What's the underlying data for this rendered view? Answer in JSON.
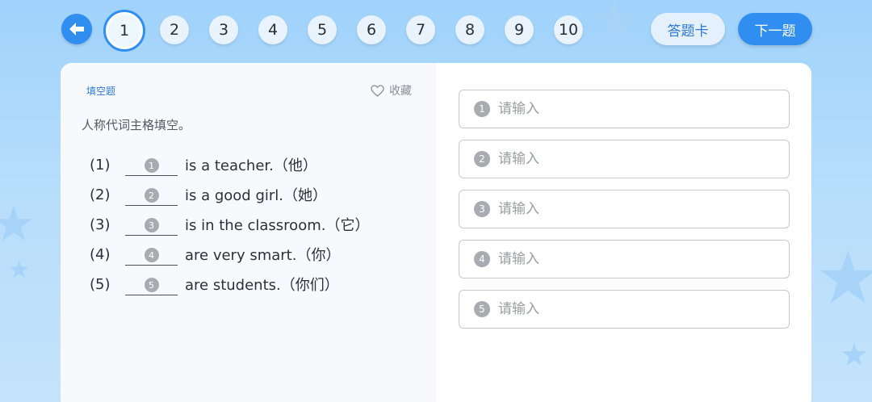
{
  "nav": {
    "questions": [
      "1",
      "2",
      "3",
      "4",
      "5",
      "6",
      "7",
      "8",
      "9",
      "10"
    ],
    "current": "1",
    "answer_card_label": "答题卡",
    "next_label": "下一题"
  },
  "question": {
    "type_label": "填空题",
    "favorite_label": "收藏",
    "instruction": "人称代词主格填空。",
    "items": [
      {
        "num": "(1)",
        "badge": "1",
        "text": "is a teacher.（他）"
      },
      {
        "num": "(2)",
        "badge": "2",
        "text": "is a good girl.（她）"
      },
      {
        "num": "(3)",
        "badge": "3",
        "text": "is in the classroom.（它）"
      },
      {
        "num": "(4)",
        "badge": "4",
        "text": "are very smart.（你）"
      },
      {
        "num": "(5)",
        "badge": "5",
        "text": "are students.（你们）"
      }
    ]
  },
  "answers": [
    {
      "badge": "1",
      "placeholder": "请输入",
      "value": ""
    },
    {
      "badge": "2",
      "placeholder": "请输入",
      "value": ""
    },
    {
      "badge": "3",
      "placeholder": "请输入",
      "value": ""
    },
    {
      "badge": "4",
      "placeholder": "请输入",
      "value": ""
    },
    {
      "badge": "5",
      "placeholder": "请输入",
      "value": ""
    }
  ],
  "colors": {
    "accent": "#2f8ef0",
    "background": "#b6ddfb",
    "badge": "#a8abaf"
  }
}
